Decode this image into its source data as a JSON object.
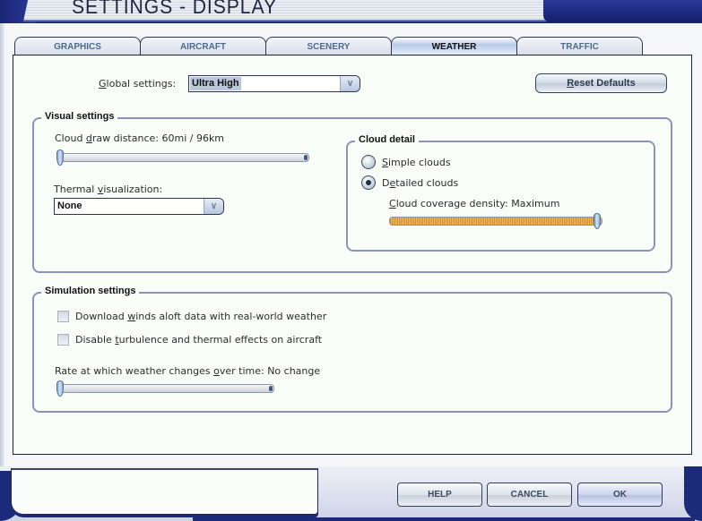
{
  "window": {
    "title": "SETTINGS - DISPLAY"
  },
  "tabs": [
    {
      "label": "GRAPHICS",
      "active": false
    },
    {
      "label": "AIRCRAFT",
      "active": false
    },
    {
      "label": "SCENERY",
      "active": false
    },
    {
      "label": "WEATHER",
      "active": true
    },
    {
      "label": "TRAFFIC",
      "active": false
    }
  ],
  "global": {
    "label_prefix": "",
    "label_underlined": "G",
    "label_rest": "lobal settings:",
    "value": "Ultra High",
    "reset_label_underlined": "R",
    "reset_label_rest": "eset Defaults"
  },
  "visual": {
    "title": "Visual settings",
    "cloud_draw": {
      "label_a": "Cloud ",
      "label_u": "d",
      "label_b": "raw distance: 60mi / 96km",
      "value_fraction": 0.0
    },
    "thermal": {
      "label_a": "Thermal ",
      "label_u": "v",
      "label_b": "isualization:",
      "value": "None"
    },
    "cloud_detail": {
      "title": "Cloud detail",
      "simple": {
        "label_u": "S",
        "label_rest": "imple clouds",
        "checked": false
      },
      "detailed": {
        "label_a": "D",
        "label_u": "e",
        "label_rest": "tailed clouds",
        "checked": true
      },
      "density": {
        "label_u": "C",
        "label_rest": "loud coverage density: Maximum",
        "value_fraction": 1.0
      }
    }
  },
  "simulation": {
    "title": "Simulation settings",
    "winds_aloft": {
      "label_a": "Download ",
      "label_u": "w",
      "label_b": "inds aloft data with real-world weather",
      "checked": false
    },
    "turbulence": {
      "label_a": "Disable ",
      "label_u": "t",
      "label_b": "urbulence and thermal effects on aircraft",
      "checked": false
    },
    "rate": {
      "label_a": "Rate at which weather changes ",
      "label_u": "o",
      "label_b": "ver time: No change",
      "value_fraction": 0.0
    }
  },
  "footer": {
    "help": "HELP",
    "cancel": "CANCEL",
    "ok": "OK",
    "status_text": ""
  }
}
